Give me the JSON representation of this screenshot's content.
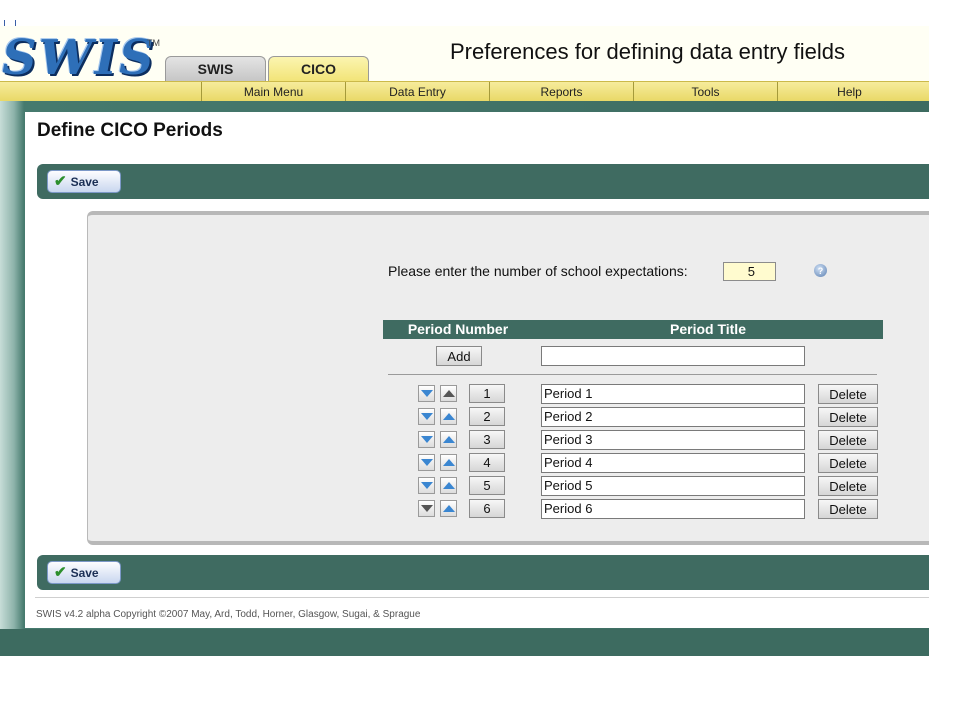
{
  "header": {
    "logo": "SWIS",
    "trademark": "TM",
    "tabs": [
      {
        "label": "SWIS",
        "active": false
      },
      {
        "label": "CICO",
        "active": true
      }
    ],
    "title": "Preferences for defining data entry fields"
  },
  "nav": {
    "items": [
      {
        "label": "Main Menu"
      },
      {
        "label": "Data Entry"
      },
      {
        "label": "Reports"
      },
      {
        "label": "Tools"
      },
      {
        "label": "Help"
      }
    ]
  },
  "page": {
    "title": "Define CICO Periods",
    "save_label": "Save"
  },
  "form": {
    "expectations_label": "Please enter the number of school expectations:",
    "expectations_value": "5",
    "help_icon": "?"
  },
  "table": {
    "headers": [
      "Period Number",
      "Period Title"
    ],
    "add_label": "Add",
    "new_title_value": "",
    "delete_label": "Delete",
    "rows": [
      {
        "number": "1",
        "title": "Period 1",
        "up_enabled": false,
        "down_enabled": true
      },
      {
        "number": "2",
        "title": "Period 2",
        "up_enabled": true,
        "down_enabled": true
      },
      {
        "number": "3",
        "title": "Period 3",
        "up_enabled": true,
        "down_enabled": true
      },
      {
        "number": "4",
        "title": "Period 4",
        "up_enabled": true,
        "down_enabled": true
      },
      {
        "number": "5",
        "title": "Period 5",
        "up_enabled": true,
        "down_enabled": true
      },
      {
        "number": "6",
        "title": "Period 6",
        "up_enabled": true,
        "down_enabled": false
      }
    ]
  },
  "footer": {
    "copyright": "SWIS v4.2 alpha Copyright ©2007 May, Ard, Todd, Horner, Glasgow, Sugai, & Sprague"
  },
  "colors": {
    "accent_green": "#3f6b61",
    "nav_yellow": "#eedf76",
    "arrow_blue": "#3a86d1"
  }
}
